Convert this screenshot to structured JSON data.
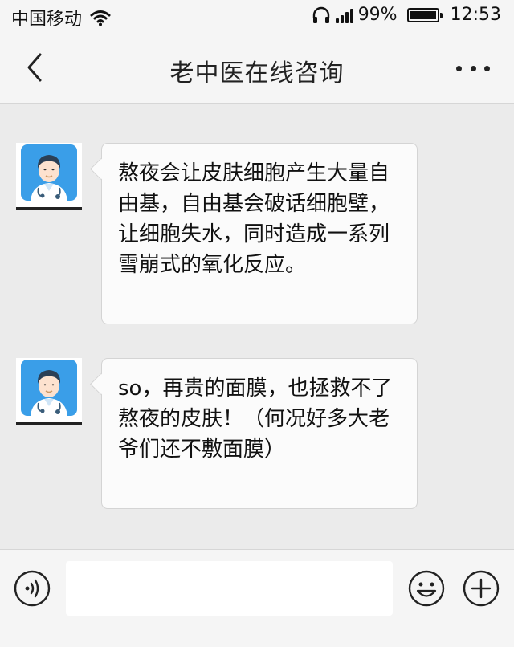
{
  "status": {
    "carrier": "中国移动",
    "battery": "99%",
    "time": "12:53"
  },
  "header": {
    "title": "老中医在线咨询"
  },
  "messages": [
    {
      "text": "熬夜会让皮肤细胞产生大量自由基，自由基会破话细胞壁，让细胞失水，同时造成一系列雪崩式的氧化反应。"
    },
    {
      "text": "so，再贵的面膜，也拯救不了熬夜的皮肤！（何况好多大老爷们还不敷面膜）"
    }
  ],
  "input": {
    "value": ""
  },
  "colors": {
    "avatar_bg": "#3a9ee8",
    "background": "#ebebeb"
  }
}
